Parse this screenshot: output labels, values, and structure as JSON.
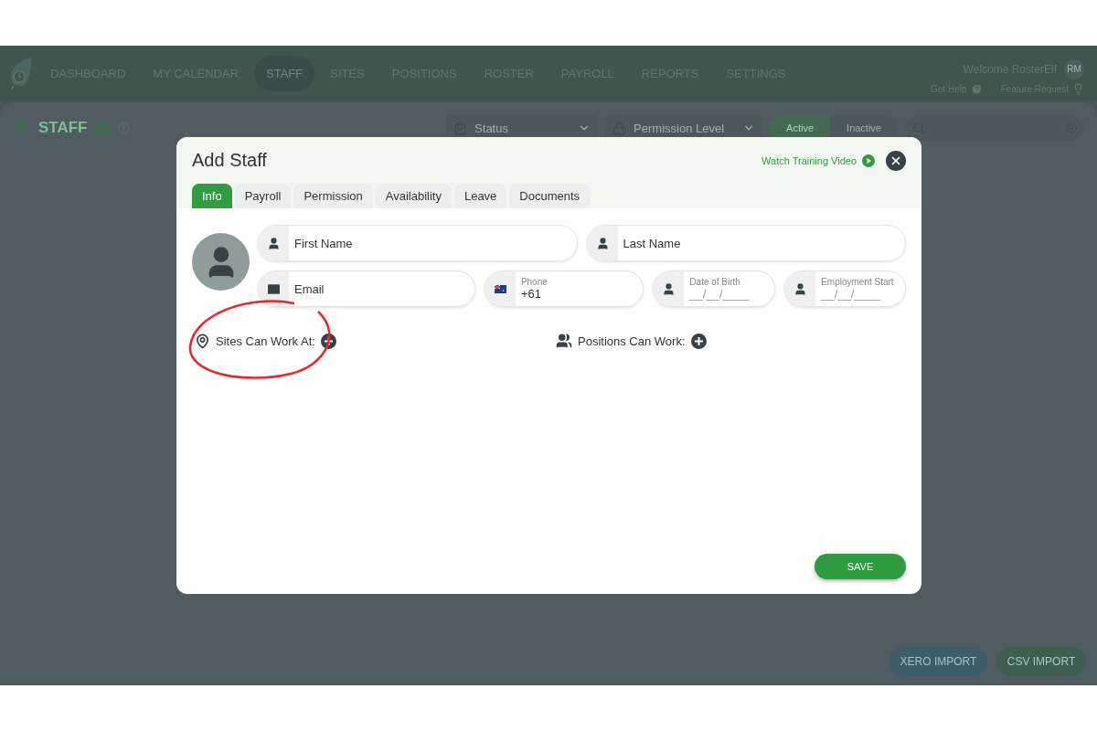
{
  "nav": {
    "items": [
      {
        "label": "DASHBOARD",
        "selected": false
      },
      {
        "label": "MY CALENDAR",
        "selected": false
      },
      {
        "label": "STAFF",
        "selected": true
      },
      {
        "label": "SITES",
        "selected": false
      },
      {
        "label": "POSITIONS",
        "selected": false
      },
      {
        "label": "ROSTER",
        "selected": false
      },
      {
        "label": "PAYROLL",
        "selected": false
      },
      {
        "label": "REPORTS",
        "selected": false
      },
      {
        "label": "SETTINGS",
        "selected": false
      }
    ],
    "welcome": "Welcome RosterElf",
    "avatar": "RM",
    "links": [
      {
        "label": "Get Help",
        "kind": "help"
      },
      {
        "label": "Feature Request",
        "kind": "idea"
      }
    ]
  },
  "page": {
    "title": "STAFF",
    "status": "Status",
    "permission": "Permission Level",
    "toggle": [
      {
        "label": "Active",
        "selected": true
      },
      {
        "label": "Inactive",
        "selected": false
      }
    ],
    "imports": [
      {
        "label": "XERO IMPORT",
        "kind": "xero"
      },
      {
        "label": "CSV IMPORT",
        "kind": "csv"
      }
    ]
  },
  "modal": {
    "title": "Add Staff",
    "training_link": "Watch Training Video",
    "tabs": [
      {
        "label": "Info",
        "selected": true
      },
      {
        "label": "Payroll",
        "selected": false
      },
      {
        "label": "Permission",
        "selected": false
      },
      {
        "label": "Availability",
        "selected": false
      },
      {
        "label": "Leave",
        "selected": false
      },
      {
        "label": "Documents",
        "selected": false
      }
    ],
    "rows": [
      [
        {
          "kind": "plain",
          "placeholder": "First Name"
        },
        {
          "kind": "plain",
          "placeholder": "Last Name"
        }
      ],
      [
        {
          "kind": "plain",
          "placeholder": "Email"
        },
        {
          "kind": "labeled",
          "label": "Phone",
          "value": "+61"
        },
        {
          "kind": "labeled",
          "label": "Date of Birth",
          "placeholder": "__/__/____"
        },
        {
          "kind": "labeled",
          "label": "Employment Start",
          "placeholder": "__/__/____"
        }
      ]
    ],
    "sections": [
      {
        "label": "Sites Can Work At:",
        "annotated": true
      },
      {
        "label": "Positions Can Work:",
        "annotated": false
      }
    ],
    "save": "SAVE"
  }
}
